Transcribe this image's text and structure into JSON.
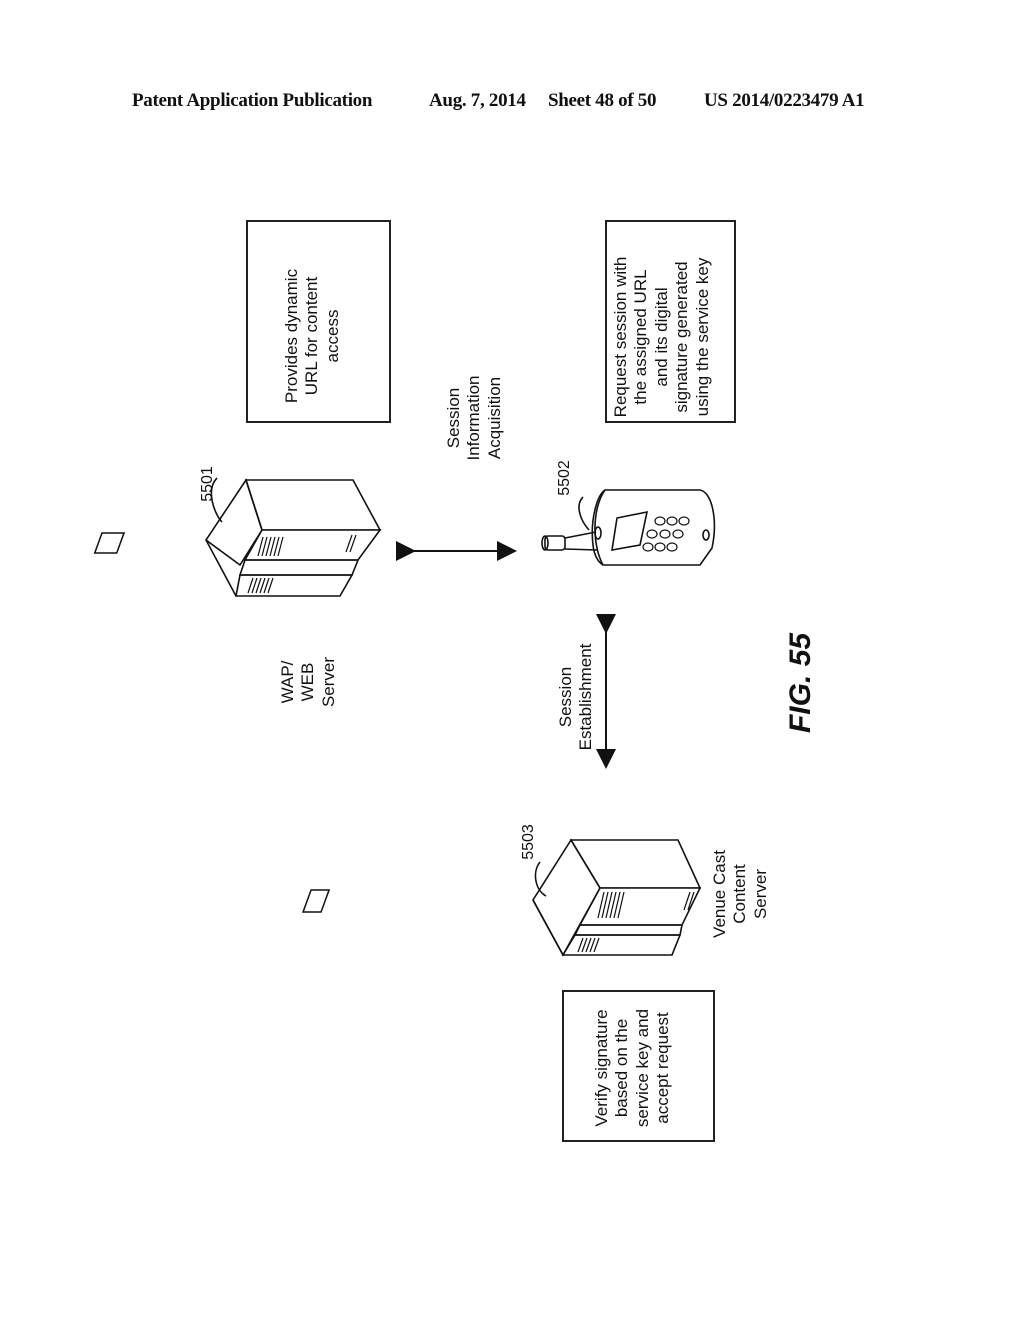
{
  "header": {
    "publication": "Patent Application Publication",
    "date": "Aug. 7, 2014",
    "sheet": "Sheet 48 of 50",
    "number": "US 2014/0223479 A1"
  },
  "figure": {
    "label": "FIG. 55"
  },
  "boxes": {
    "wap_note": [
      "Provides dynamic",
      "URL for content",
      "access"
    ],
    "phone_note": [
      "Request session with",
      "the assigned URL",
      "and its digital",
      "signature generated",
      "using the service key"
    ],
    "venue_note": [
      "Verify signature",
      "based on the",
      "service key and",
      "accept request"
    ]
  },
  "nodes": {
    "wap_server": {
      "ref": "5501",
      "label": [
        "WAP/",
        "WEB",
        "Server"
      ]
    },
    "phone": {
      "ref": "5502"
    },
    "venue_server": {
      "ref": "5503",
      "label": [
        "Venue Cast",
        "Content",
        "Server"
      ]
    }
  },
  "arrows": {
    "acquisition": [
      "Session",
      "Information",
      "Acquisition"
    ],
    "establishment": [
      "Session",
      "Establishment"
    ]
  }
}
